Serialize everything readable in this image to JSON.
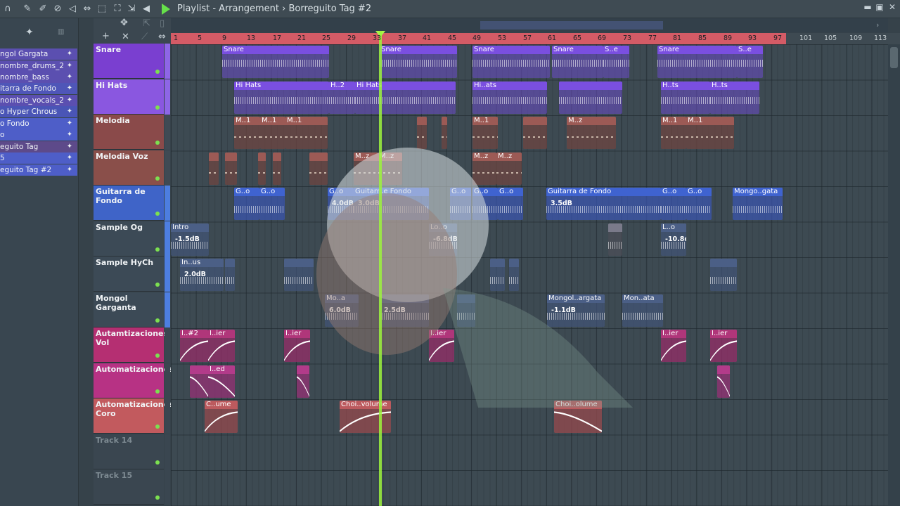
{
  "window": {
    "title": "Playlist - Arrangement",
    "separator": "›",
    "pattern": "Borreguito Tag #2",
    "minimize": "▬",
    "restore": "▣",
    "close": "✕"
  },
  "picker": {
    "items": [
      "ngol Gargata",
      "nombre_drums_2",
      "nombre_bass",
      "itarra de Fondo",
      "nombre_vocals_2",
      "o Hyper Chrous",
      "o Fondo",
      "o",
      "eguito Tag",
      "5",
      "eguito Tag #2"
    ]
  },
  "ruler": {
    "numbers": [
      "1",
      "5",
      "9",
      "13",
      "17",
      "21",
      "25",
      "29",
      "33",
      "37",
      "41",
      "45",
      "49",
      "53",
      "57",
      "61",
      "65",
      "69",
      "73",
      "77",
      "81",
      "85",
      "89",
      "93",
      "97",
      "101",
      "105",
      "109",
      "113"
    ]
  },
  "tracks": [
    {
      "name": "Snare",
      "color": "#7a3fd0"
    },
    {
      "name": "Hi Hats",
      "color": "#8a57e0"
    },
    {
      "name": "Melodia",
      "color": "#8a4a4a"
    },
    {
      "name": "Melodia Voz",
      "color": "#8a4f4a"
    },
    {
      "name": "Guitarra de Fondo",
      "color": "#3f64c8"
    },
    {
      "name": "Sample Og",
      "color": "#3c4a56"
    },
    {
      "name": "Sample HyCh",
      "color": "#3c4a56"
    },
    {
      "name": "Mongol Garganta",
      "color": "#3c4a56"
    },
    {
      "name": "Autamtizaciones Vol",
      "color": "#b52f72"
    },
    {
      "name": "Automatizaciones",
      "color": "#b73284"
    },
    {
      "name": "Automatizaciones Coro",
      "color": "#c25a5e"
    },
    {
      "name": "Track 14",
      "color": "#3a4650"
    },
    {
      "name": "Track 15",
      "color": "#3a4650"
    }
  ],
  "clips": {
    "snare": [
      "Snare",
      "Snare",
      "Snare",
      "Snare",
      "S..e",
      "Snare",
      "S..e"
    ],
    "hihats": [
      "Hi Hats",
      "H..2",
      "Hi Hats",
      "Hi..ats",
      "H..ts",
      "H..ts"
    ],
    "melodia": [
      "M..1",
      "M..1",
      "M..1",
      "M..1",
      "M..z",
      "M..1",
      "M..1"
    ],
    "melodia_voz": [
      "M..z",
      "M..z",
      "M..z",
      "M..z"
    ],
    "guitarra": [
      "G..o",
      "G..o",
      "G..o",
      "Guitarr..e Fondo",
      "G..o",
      "G..o",
      "G..o",
      "Guitarra de Fondo",
      "G..o",
      "G..o",
      "Mongo..gata"
    ],
    "guitarra_vals": [
      "4.0dB",
      "3.0dB",
      "3.5dB"
    ],
    "sample_og": [
      "Intro",
      "Lo..o",
      "L..o"
    ],
    "sample_og_vals": [
      "-1.5dB",
      "-6.8dB",
      "-10.8dB"
    ],
    "sample_hych": [
      "In..us"
    ],
    "sample_hych_vals": [
      "2.0dB"
    ],
    "mongol": [
      "Mo..a",
      "Mongol..argata",
      "Mon..ata"
    ],
    "mongol_vals": [
      "6.0dB",
      "2.5dB",
      "-1.1dB"
    ],
    "autvol": [
      "I..#2",
      "I..ier",
      "I..ier",
      "I..ier",
      "I..ier",
      "I..ier"
    ],
    "autom": [
      "I..ed"
    ],
    "autcoro": [
      "C..ume",
      "Choi..volume",
      "Choi..olume"
    ]
  }
}
